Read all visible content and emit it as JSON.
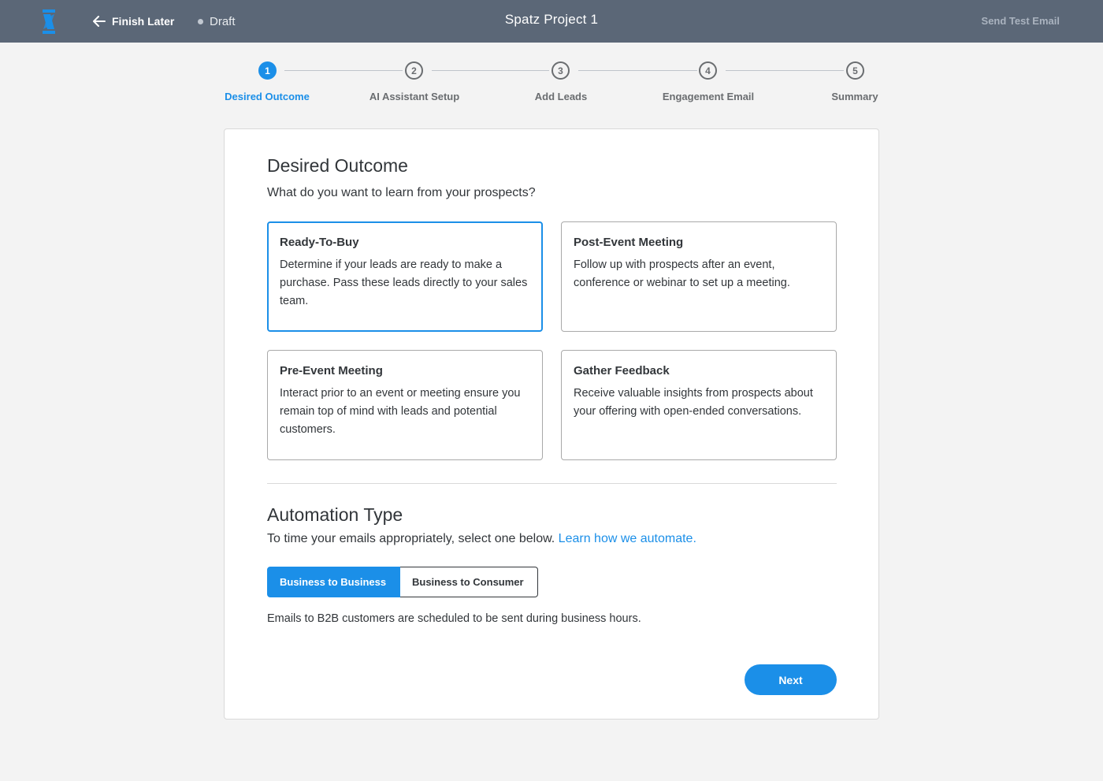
{
  "topbar": {
    "finish_later": "Finish Later",
    "status": "Draft",
    "project_title": "Spatz Project 1",
    "send_test_email": "Send Test Email",
    "brand_color": "#1b8fe8",
    "bar_color": "#5b6777"
  },
  "steps": [
    {
      "number": "1",
      "label": "Desired Outcome",
      "active": true
    },
    {
      "number": "2",
      "label": "AI Assistant Setup",
      "active": false
    },
    {
      "number": "3",
      "label": "Add Leads",
      "active": false
    },
    {
      "number": "4",
      "label": "Engagement Email",
      "active": false
    },
    {
      "number": "5",
      "label": "Summary",
      "active": false
    }
  ],
  "desired_outcome": {
    "title": "Desired Outcome",
    "question": "What do you want to learn from your prospects?",
    "options": [
      {
        "title": "Ready-To-Buy",
        "description": "Determine if your leads are ready to make a purchase. Pass these leads directly to your sales team.",
        "selected": true
      },
      {
        "title": "Post-Event Meeting",
        "description": "Follow up with prospects after an event, conference or webinar to set up a meeting.",
        "selected": false
      },
      {
        "title": "Pre-Event Meeting",
        "description": "Interact prior to an event or meeting ensure you remain top of mind with  leads and potential customers.",
        "selected": false
      },
      {
        "title": "Gather Feedback",
        "description": "Receive valuable insights from prospects about your offering with open-ended conversations.",
        "selected": false
      }
    ]
  },
  "automation": {
    "title": "Automation Type",
    "subtitle": "To time your emails appropriately, select one below.",
    "link": "Learn how we automate.",
    "b2b_label": "Business to Business",
    "b2c_label": "Business to Consumer",
    "helper": "Emails to B2B customers are scheduled to be sent during business hours."
  },
  "next_label": "Next"
}
